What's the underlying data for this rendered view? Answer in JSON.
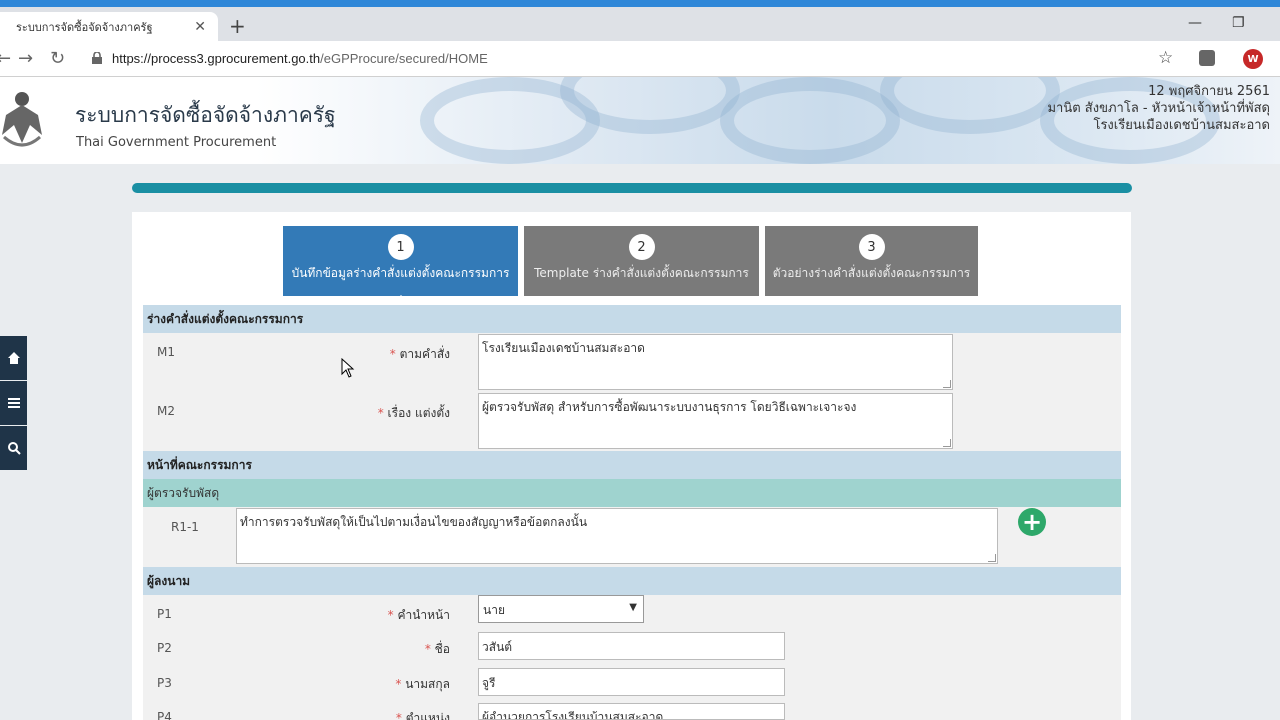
{
  "browser": {
    "tab_title": "ระบบการจัดซื้อจัดจ้างภาครัฐ",
    "tab_close": "✕",
    "new_tab": "+",
    "minimize": "—",
    "restore": "❐",
    "close": "✕",
    "url_host": "https://process3.gprocurement.go.th",
    "url_path": "/eGPProcure/secured/HOME",
    "profile_initial": "W"
  },
  "header": {
    "title": "ระบบการจัดซื้อจัดจ้างภาครัฐ",
    "subtitle": "Thai Government Procurement",
    "date": "12 พฤศจิกายน 2561",
    "user": "มานิต สังขภาโล - หัวหน้าเจ้าหน้าที่พัสดุ",
    "org": "โรงเรียนเมืองเดชบ้านสมสะอาด"
  },
  "steps": [
    {
      "num": "1",
      "label": "บันทึกข้อมูลร่างคำสั่งแต่งตั้งคณะกรรมการ"
    },
    {
      "num": "2",
      "label": "Template ร่างคำสั่งแต่งตั้งคณะกรรมการ"
    },
    {
      "num": "3",
      "label": "ตัวอย่างร่างคำสั่งแต่งตั้งคณะกรรมการ"
    }
  ],
  "sections": {
    "draft": "ร่างคำสั่งแต่งตั้งคณะกรรมการ",
    "duty": "หน้าที่คณะกรรมการ",
    "inspector": "ผู้ตรวจรับพัสดุ",
    "signer": "ผู้ลงนาม"
  },
  "form": {
    "m1": {
      "code": "M1",
      "req": "*",
      "label": "ตามคำสั่ง",
      "value": "โรงเรียนเมืองเดชบ้านสมสะอาด"
    },
    "m2": {
      "code": "M2",
      "req": "*",
      "label": "เรื่อง แต่งตั้ง",
      "value": "ผู้ตรวจรับพัสดุ สำหรับการซื้อพัฒนาระบบงานธุรการ โดยวิธีเฉพาะเจาะจง"
    },
    "r1": {
      "code": "R1-1",
      "value": "ทำการตรวจรับพัสดุให้เป็นไปตามเงื่อนไขของสัญญาหรือข้อตกลงนั้น"
    },
    "p1": {
      "code": "P1",
      "req": "*",
      "label": "คำนำหน้า",
      "value": "นาย"
    },
    "p2": {
      "code": "P2",
      "req": "*",
      "label": "ชื่อ",
      "value": "วสันต์"
    },
    "p3": {
      "code": "P3",
      "req": "*",
      "label": "นามสกุล",
      "value": "จูรี"
    },
    "p4": {
      "code": "P4",
      "req": "*",
      "label": "ตำแหน่ง",
      "value": "ผู้อำนวยการโรงเรียนบ้านสมสะอาด"
    }
  },
  "icons": {
    "home": "home-icon",
    "menu": "menu-icon",
    "search": "search-icon",
    "add": "plus-circle-icon"
  },
  "colors": {
    "accent": "#337ab7",
    "step_inactive": "#7a7a7a",
    "section": "#c5dae8",
    "subsection": "#9fd3cf",
    "progress": "#1a8fa3",
    "add_button": "#2ea86a"
  }
}
